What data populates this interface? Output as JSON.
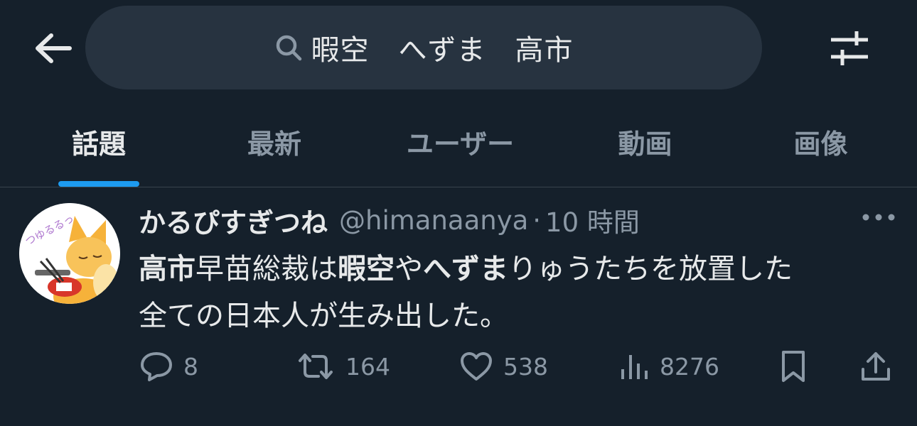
{
  "search": {
    "query": "暇空　へずま　高市"
  },
  "tabs": [
    {
      "label": "話題",
      "active": true
    },
    {
      "label": "最新",
      "active": false
    },
    {
      "label": "ユーザー",
      "active": false
    },
    {
      "label": "動画",
      "active": false
    },
    {
      "label": "画像",
      "active": false
    }
  ],
  "tweet": {
    "display_name": "かるぴすぎつね",
    "handle": "@himanaanya",
    "separator": "·",
    "time": "10 時間",
    "body_line1": [
      {
        "text": "高市",
        "bold": true
      },
      {
        "text": "早苗総裁は",
        "bold": false
      },
      {
        "text": "暇空",
        "bold": true
      },
      {
        "text": "や",
        "bold": false
      },
      {
        "text": "へずま",
        "bold": true
      },
      {
        "text": "りゅうたちを放置した",
        "bold": false
      }
    ],
    "body_line2": "全ての日本人が生み出した。",
    "replies": "8",
    "retweets": "164",
    "likes": "538",
    "views": "8276"
  },
  "colors": {
    "background": "#15202b",
    "search_bg": "#273340",
    "accent": "#1d9bf0",
    "text_primary": "#e7e9ea",
    "text_secondary": "#8b98a5"
  },
  "icons": [
    "back-arrow-icon",
    "search-icon",
    "filter-sliders-icon",
    "more-dots-icon",
    "reply-icon",
    "retweet-icon",
    "like-heart-icon",
    "views-chart-icon",
    "bookmark-icon",
    "share-icon"
  ]
}
